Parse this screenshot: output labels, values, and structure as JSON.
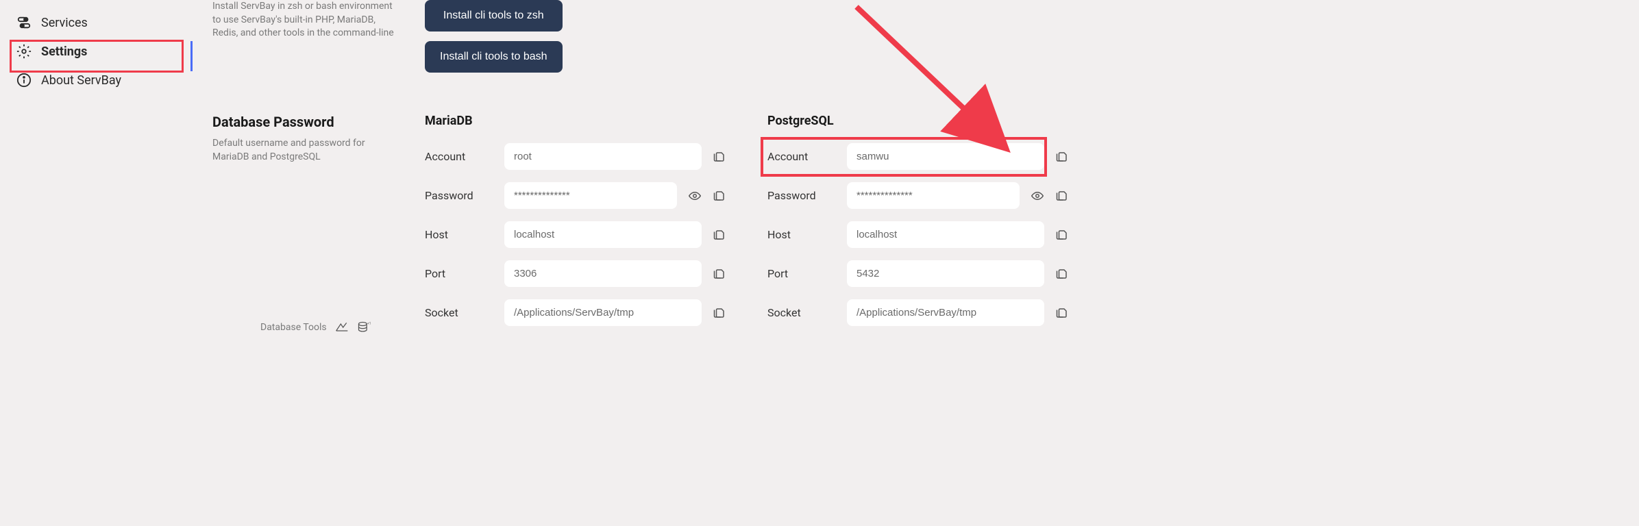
{
  "sidebar": {
    "items": [
      {
        "label": "Services"
      },
      {
        "label": "Settings"
      },
      {
        "label": "About ServBay"
      }
    ]
  },
  "cli": {
    "description": "Install ServBay in zsh or bash environment to use ServBay's built-in PHP, MariaDB, Redis, and other tools in the command-line",
    "zsh_button": "Install cli tools to zsh",
    "bash_button": "Install cli tools to bash"
  },
  "db": {
    "title": "Database Password",
    "description": "Default username and password for MariaDB and PostgreSQL",
    "tools_label": "Database Tools",
    "labels": {
      "account": "Account",
      "password": "Password",
      "host": "Host",
      "port": "Port",
      "socket": "Socket"
    },
    "mariadb": {
      "title": "MariaDB",
      "account": "root",
      "password": "**************",
      "host": "localhost",
      "port": "3306",
      "socket": "/Applications/ServBay/tmp"
    },
    "postgresql": {
      "title": "PostgreSQL",
      "account": "samwu",
      "password": "**************",
      "host": "localhost",
      "port": "5432",
      "socket": "/Applications/ServBay/tmp"
    }
  }
}
